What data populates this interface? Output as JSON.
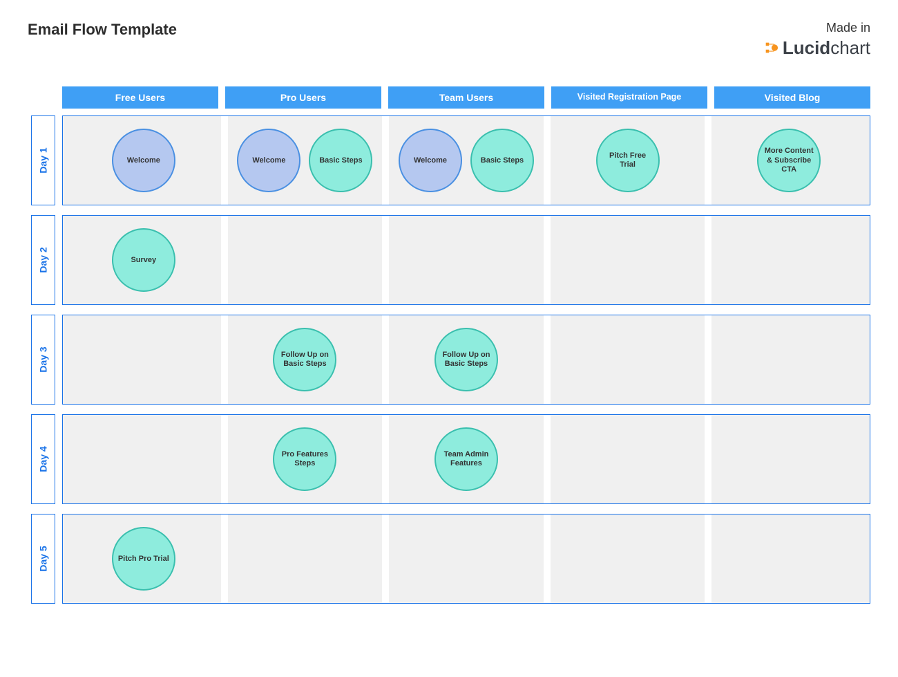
{
  "title": "Email Flow Template",
  "branding": {
    "madeIn": "Made in",
    "logoBold": "Lucid",
    "logoLight": "chart"
  },
  "colors": {
    "headerBg": "#3f9ff5",
    "border": "#1a73e8",
    "cellBg": "#f0f0f0",
    "bubbleBlueFill": "#b5c8f0",
    "bubbleBlueStroke": "#4a90e2",
    "bubbleTealFill": "#8eecdd",
    "bubbleTealStroke": "#3abfae",
    "logoAccent": "#f7941e"
  },
  "columns": [
    {
      "label": "Free Users",
      "size": "normal"
    },
    {
      "label": "Pro Users",
      "size": "normal"
    },
    {
      "label": "Team Users",
      "size": "normal"
    },
    {
      "label": "Visited  Registration Page",
      "size": "small"
    },
    {
      "label": "Visited Blog",
      "size": "normal"
    }
  ],
  "rows": [
    {
      "label": "Day 1",
      "cells": [
        [
          {
            "text": "Welcome",
            "style": "blue"
          }
        ],
        [
          {
            "text": "Welcome",
            "style": "blue"
          },
          {
            "text": "Basic Steps",
            "style": "teal"
          }
        ],
        [
          {
            "text": "Welcome",
            "style": "blue"
          },
          {
            "text": "Basic Steps",
            "style": "teal"
          }
        ],
        [
          {
            "text": "Pitch Free Trial",
            "style": "teal"
          }
        ],
        [
          {
            "text": "More Content & Subscribe CTA",
            "style": "teal"
          }
        ]
      ]
    },
    {
      "label": "Day 2",
      "cells": [
        [
          {
            "text": "Survey",
            "style": "teal"
          }
        ],
        [],
        [],
        [],
        []
      ]
    },
    {
      "label": "Day 3",
      "cells": [
        [],
        [
          {
            "text": "Follow Up on Basic Steps",
            "style": "teal"
          }
        ],
        [
          {
            "text": "Follow Up on Basic Steps",
            "style": "teal"
          }
        ],
        [],
        []
      ]
    },
    {
      "label": "Day 4",
      "cells": [
        [],
        [
          {
            "text": "Pro Features Steps",
            "style": "teal"
          }
        ],
        [
          {
            "text": "Team Admin Features",
            "style": "teal"
          }
        ],
        [],
        []
      ]
    },
    {
      "label": "Day 5",
      "cells": [
        [
          {
            "text": "Pitch Pro Trial",
            "style": "teal"
          }
        ],
        [],
        [],
        [],
        []
      ]
    }
  ]
}
